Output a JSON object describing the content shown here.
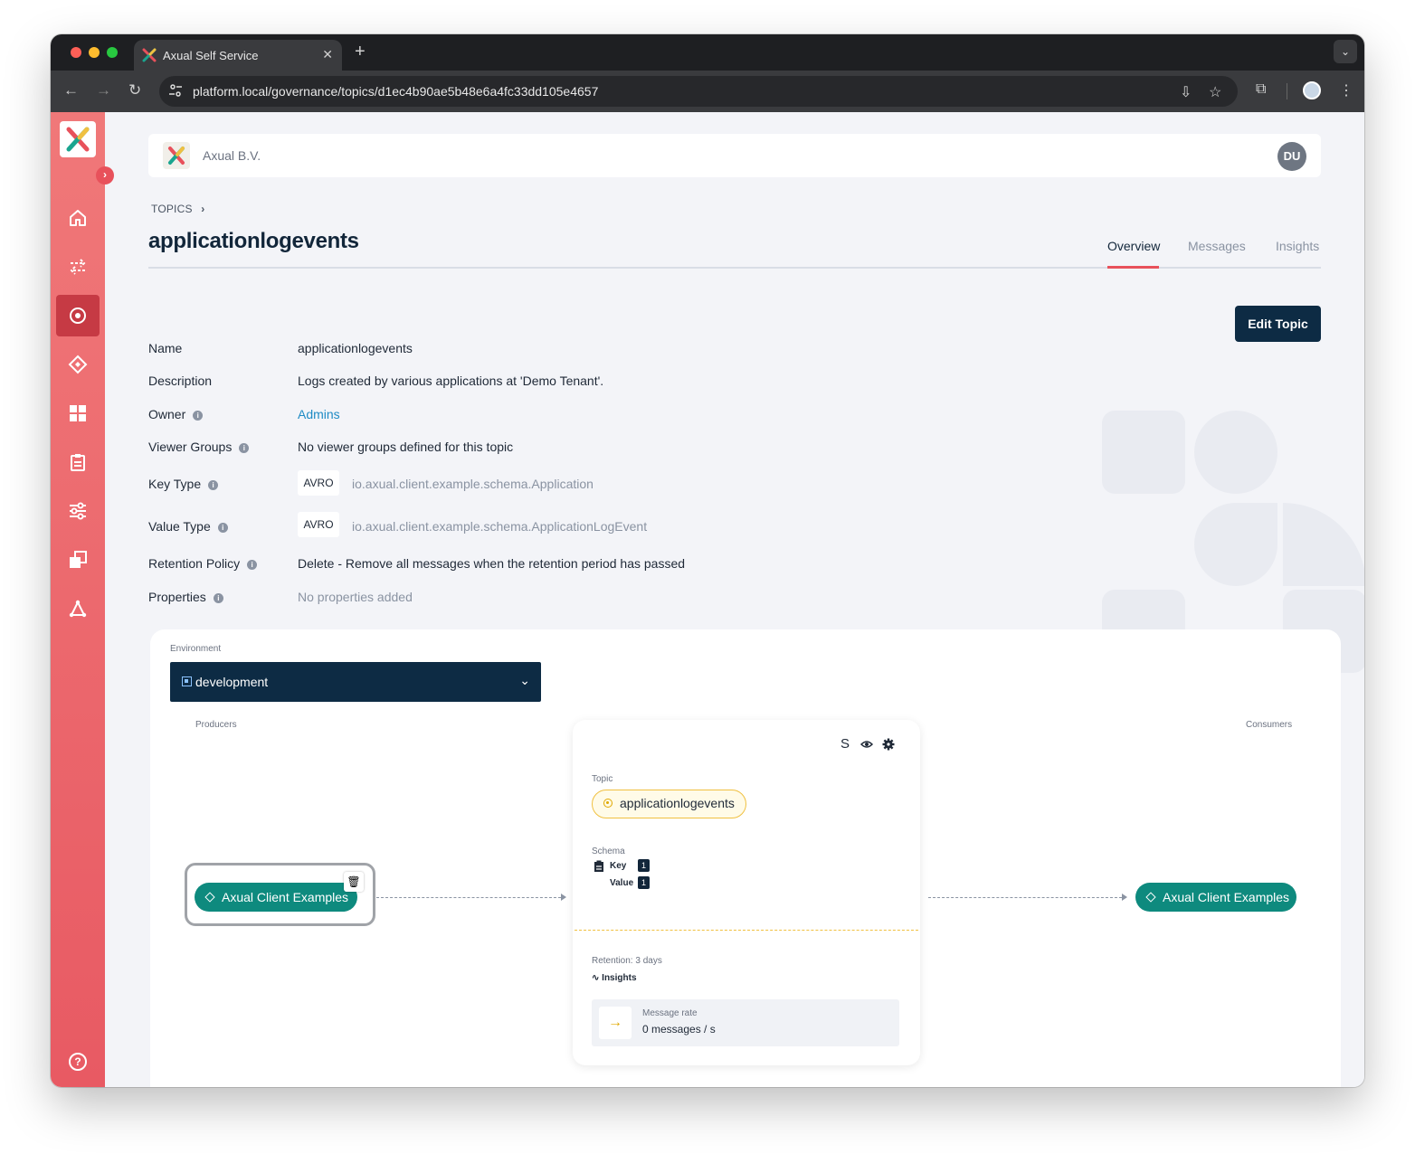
{
  "browser": {
    "tab_title": "Axual Self Service",
    "tab_close": "✕",
    "new_tab": "+",
    "url": "platform.local/governance/topics/d1ec4b90ae5b48e6a4fc33dd105e4657"
  },
  "header": {
    "org_name": "Axual B.V.",
    "avatar_initials": "DU"
  },
  "breadcrumb": {
    "item": "TOPICS",
    "separator": "›"
  },
  "page": {
    "title": "applicationlogevents",
    "tabs": [
      {
        "label": "Overview",
        "active": true
      },
      {
        "label": "Messages",
        "active": false
      },
      {
        "label": "Insights",
        "active": false
      }
    ],
    "edit_button": "Edit Topic"
  },
  "details": {
    "name_label": "Name",
    "name_value": "applicationlogevents",
    "description_label": "Description",
    "description_value": "Logs created by various applications at 'Demo Tenant'.",
    "owner_label": "Owner",
    "owner_value": "Admins",
    "viewer_groups_label": "Viewer Groups",
    "viewer_groups_value": "No viewer groups defined for this topic",
    "key_type_label": "Key Type",
    "key_type_format": "AVRO",
    "key_type_schema": "io.axual.client.example.schema.Application",
    "value_type_label": "Value Type",
    "value_type_format": "AVRO",
    "value_type_schema": "io.axual.client.example.schema.ApplicationLogEvent",
    "retention_label": "Retention Policy",
    "retention_value": "Delete - Remove all messages when the retention period has passed",
    "properties_label": "Properties",
    "properties_value": "No properties added"
  },
  "environment": {
    "label": "Environment",
    "selected": "development",
    "producers_label": "Producers",
    "consumers_label": "Consumers",
    "producer_app": "Axual Client Examples",
    "consumer_app": "Axual Client Examples"
  },
  "topic_card": {
    "icon_s": "S",
    "topic_label": "Topic",
    "topic_name": "applicationlogevents",
    "schema_label": "Schema",
    "key_label": "Key",
    "key_version": "1",
    "value_label": "Value",
    "value_version": "1",
    "retention": "Retention: 3 days",
    "insights_link": "Insights",
    "message_rate_label": "Message rate",
    "message_rate_value": "0 messages / s"
  },
  "colors": {
    "sidebar_top": "#f07879",
    "sidebar_bottom": "#e85a63",
    "primary_dark": "#0d2b44",
    "app_teal": "#0e8a7e",
    "topic_yellow": "#f0c040",
    "tab_indicator": "#e8515b"
  }
}
